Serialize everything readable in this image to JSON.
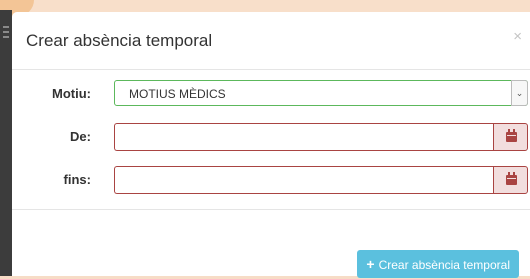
{
  "dialog": {
    "title": "Crear absència temporal",
    "close_glyph": "×"
  },
  "form": {
    "reason": {
      "label": "Motiu:",
      "selected_value": "MOTIUS MÈDICS"
    },
    "from": {
      "label": "De:",
      "value": ""
    },
    "to": {
      "label": "fins:",
      "value": ""
    }
  },
  "footer": {
    "submit_label": "Crear absència temporal",
    "submit_icon": "plus-icon"
  },
  "colors": {
    "accent_info": "#5bc0de",
    "error_border": "#a94442",
    "success_border": "#5cb85c"
  }
}
